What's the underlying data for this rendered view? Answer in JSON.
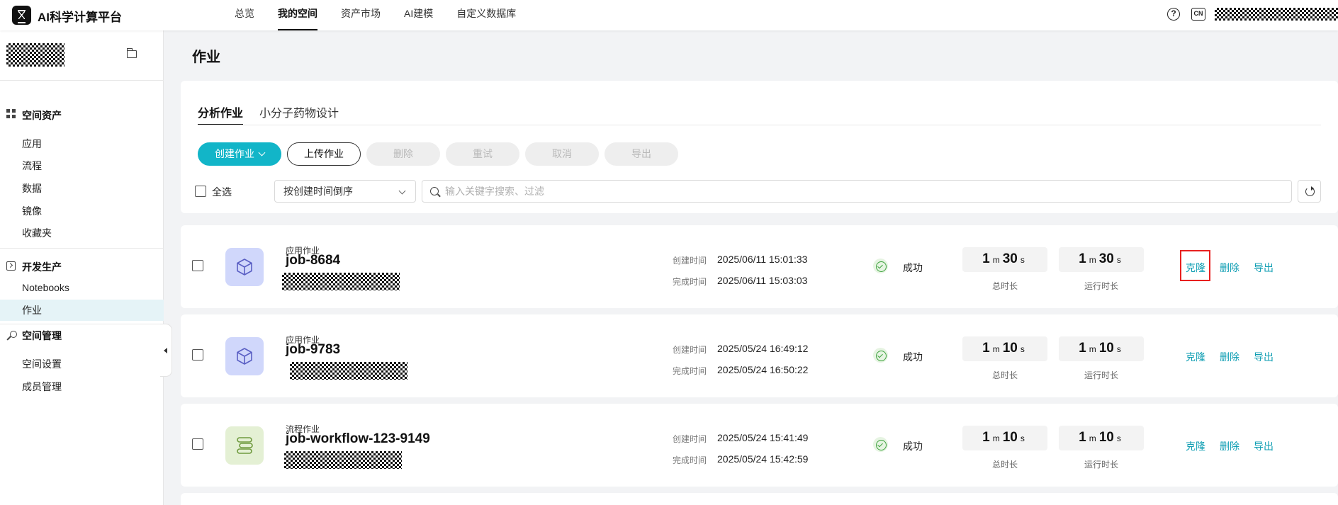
{
  "app": {
    "title": "AI科学计算平台"
  },
  "nav": [
    "总览",
    "我的空间",
    "资产市场",
    "AI建模",
    "自定义数据库"
  ],
  "header": {
    "lang_label": "CN",
    "help_label": "?"
  },
  "sidebar": {
    "groups": [
      {
        "title": "空间资产",
        "icon": "grid-icon",
        "items": [
          "应用",
          "流程",
          "数据",
          "镜像",
          "收藏夹"
        ]
      },
      {
        "title": "开发生产",
        "icon": "terminal-icon",
        "items": [
          "Notebooks",
          "作业"
        ]
      },
      {
        "title": "空间管理",
        "icon": "wrench-icon",
        "items": [
          "空间设置",
          "成员管理"
        ]
      }
    ],
    "active_item": "作业"
  },
  "page": {
    "title": "作业"
  },
  "tabs": [
    "分析作业",
    "小分子药物设计"
  ],
  "toolbar": {
    "create": "创建作业",
    "upload": "上传作业",
    "delete": "删除",
    "retry": "重试",
    "cancel": "取消",
    "export": "导出"
  },
  "filters": {
    "select_all": "全选",
    "sort": "按创建时间倒序",
    "search_placeholder": "输入关键字搜索、过滤"
  },
  "labels": {
    "created": "创建时间",
    "finished": "完成时间",
    "total_duration": "总时长",
    "run_duration": "运行时长",
    "minute_unit": "m",
    "second_unit": "s"
  },
  "jobs": [
    {
      "type": "应用作业",
      "name": "job-8684",
      "created": "2025/06/11 15:01:33",
      "finished": "2025/06/11 15:03:03",
      "status": "成功",
      "total": {
        "m": "1",
        "s": "30"
      },
      "run": {
        "m": "1",
        "s": "30"
      },
      "actions": [
        "克隆",
        "删除",
        "导出"
      ]
    },
    {
      "type": "应用作业",
      "name": "job-9783",
      "created": "2025/05/24 16:49:12",
      "finished": "2025/05/24 16:50:22",
      "status": "成功",
      "total": {
        "m": "1",
        "s": "10"
      },
      "run": {
        "m": "1",
        "s": "10"
      },
      "actions": [
        "克隆",
        "删除",
        "导出"
      ]
    },
    {
      "type": "流程作业",
      "name": "job-workflow-123-9149",
      "created": "2025/05/24 15:41:49",
      "finished": "2025/05/24 15:42:59",
      "status": "成功",
      "total": {
        "m": "1",
        "s": "10"
      },
      "run": {
        "m": "1",
        "s": "10"
      },
      "actions": [
        "克隆",
        "删除",
        "导出"
      ]
    }
  ],
  "colors": {
    "accent": "#12b5c8",
    "link": "#0f9eb3",
    "success": "#3ea33e",
    "highlight": "#e8201f"
  }
}
